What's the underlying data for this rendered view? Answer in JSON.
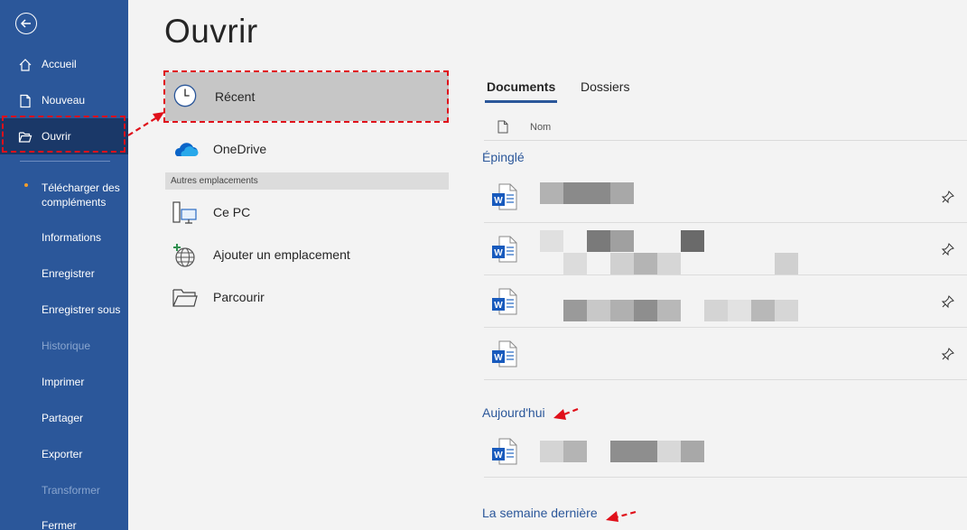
{
  "sidebar": {
    "items": [
      {
        "label": "Accueil",
        "icon": "home-icon"
      },
      {
        "label": "Nouveau",
        "icon": "new-document-icon"
      },
      {
        "label": "Ouvrir",
        "icon": "open-folder-icon"
      },
      {
        "label": "Télécharger des compléments"
      },
      {
        "label": "Informations"
      },
      {
        "label": "Enregistrer"
      },
      {
        "label": "Enregistrer sous"
      },
      {
        "label": "Historique"
      },
      {
        "label": "Imprimer"
      },
      {
        "label": "Partager"
      },
      {
        "label": "Exporter"
      },
      {
        "label": "Transformer"
      },
      {
        "label": "Fermer"
      }
    ],
    "download_label_line1": "Télécharger des",
    "download_label_line2": "compléments"
  },
  "page": {
    "title": "Ouvrir"
  },
  "locations": {
    "recent": "Récent",
    "onedrive": "OneDrive",
    "section_other": "Autres emplacements",
    "this_pc": "Ce PC",
    "add_place": "Ajouter un emplacement",
    "browse": "Parcourir"
  },
  "right": {
    "tabs": {
      "documents": "Documents",
      "folders": "Dossiers"
    },
    "column_name": "Nom",
    "groups": {
      "pinned": "Épinglé",
      "today": "Aujourd'hui",
      "last_week": "La semaine dernière"
    }
  },
  "colors": {
    "sidebar": "#2b579a",
    "sidebar_selected": "#1a3868",
    "accent": "#2b579a",
    "annotation": "#e0101a",
    "word_blue": "#185abd"
  }
}
